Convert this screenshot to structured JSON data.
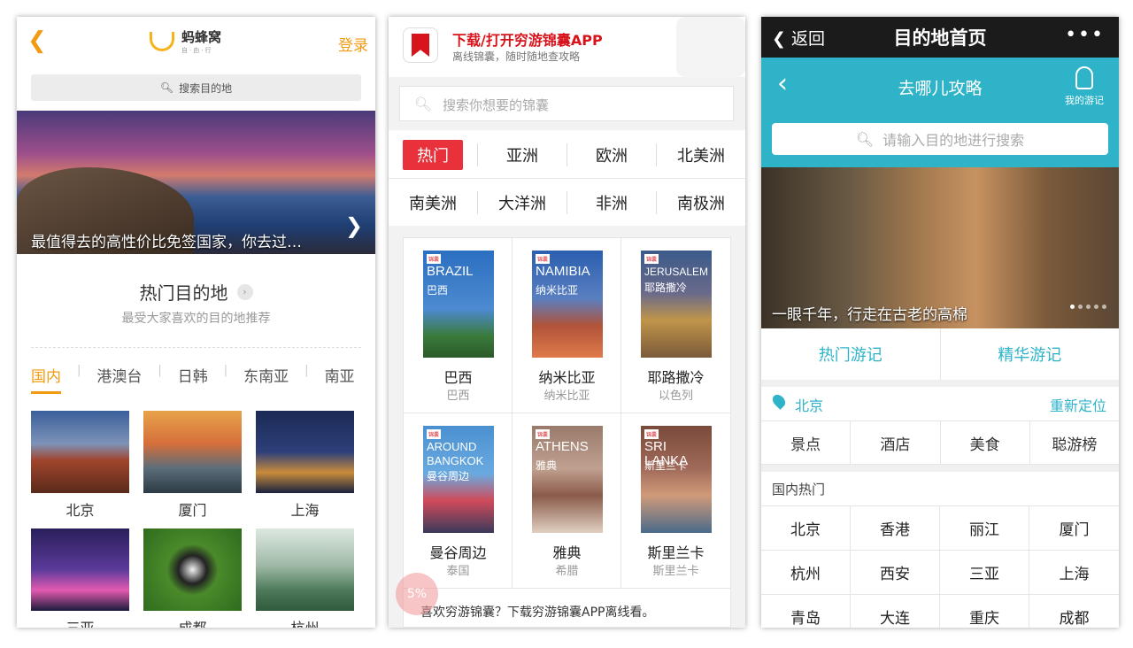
{
  "phone1": {
    "login": "登录",
    "logo_name": "蚂蜂窝",
    "logo_sub": "自·由·行",
    "search_placeholder": "搜索目的地",
    "hero_caption": "最值得去的高性价比免签国家，你去过…",
    "hot_title": "热门目的地",
    "hot_subtitle": "最受大家喜欢的目的地推荐",
    "tabs": [
      "国内",
      "港澳台",
      "日韩",
      "东南亚",
      "南亚"
    ],
    "cities": [
      "北京",
      "厦门",
      "上海",
      "三亚",
      "成都",
      "杭州"
    ],
    "accent": "#f29b12"
  },
  "phone2": {
    "banner_title": "下载/打开穷游锦囊APP",
    "banner_subtitle": "离线锦囊，随时随地查攻略",
    "search_placeholder": "搜索你想要的锦囊",
    "categories_row1": [
      "热门",
      "亚洲",
      "欧洲",
      "北美洲"
    ],
    "categories_row2": [
      "南美洲",
      "大洋洲",
      "非洲",
      "南极洲"
    ],
    "books": [
      {
        "cover_en": "BRAZIL",
        "cover_zh": "巴西",
        "name": "巴西",
        "country": "巴西"
      },
      {
        "cover_en": "NAMIBIA",
        "cover_zh": "纳米比亚",
        "name": "纳米比亚",
        "country": "纳米比亚"
      },
      {
        "cover_en": "JERUSALEM",
        "cover_zh": "耶路撒冷",
        "name": "耶路撒冷",
        "country": "以色列"
      },
      {
        "cover_en": "AROUND BANGKOK",
        "cover_zh": "曼谷周边",
        "name": "曼谷周边",
        "country": "泰国"
      },
      {
        "cover_en": "ATHENS",
        "cover_zh": "雅典",
        "name": "雅典",
        "country": "希腊"
      },
      {
        "cover_en": "SRI LANKA",
        "cover_zh": "斯里兰卡",
        "name": "斯里兰卡",
        "country": "斯里兰卡"
      }
    ],
    "footer": "喜欢穷游锦囊？下载穷游锦囊APP离线看。",
    "progress_badge": "5%",
    "accent": "#e8313a"
  },
  "phone3": {
    "nav_back": "返回",
    "nav_title": "目的地首页",
    "header_title": "去哪儿攻略",
    "my_notes": "我的游记",
    "search_placeholder": "请输入目的地进行搜索",
    "hero_caption": "一眼千年，行走在古老的高棉",
    "tabs": [
      "热门游记",
      "精华游记"
    ],
    "location": "北京",
    "relocate": "重新定位",
    "categories": [
      "景点",
      "酒店",
      "美食",
      "聪游榜"
    ],
    "section_label": "国内热门",
    "cities": [
      "北京",
      "香港",
      "丽江",
      "厦门",
      "杭州",
      "西安",
      "三亚",
      "上海",
      "青岛",
      "大连",
      "重庆",
      "成都"
    ],
    "accent": "#2eb3c8"
  }
}
